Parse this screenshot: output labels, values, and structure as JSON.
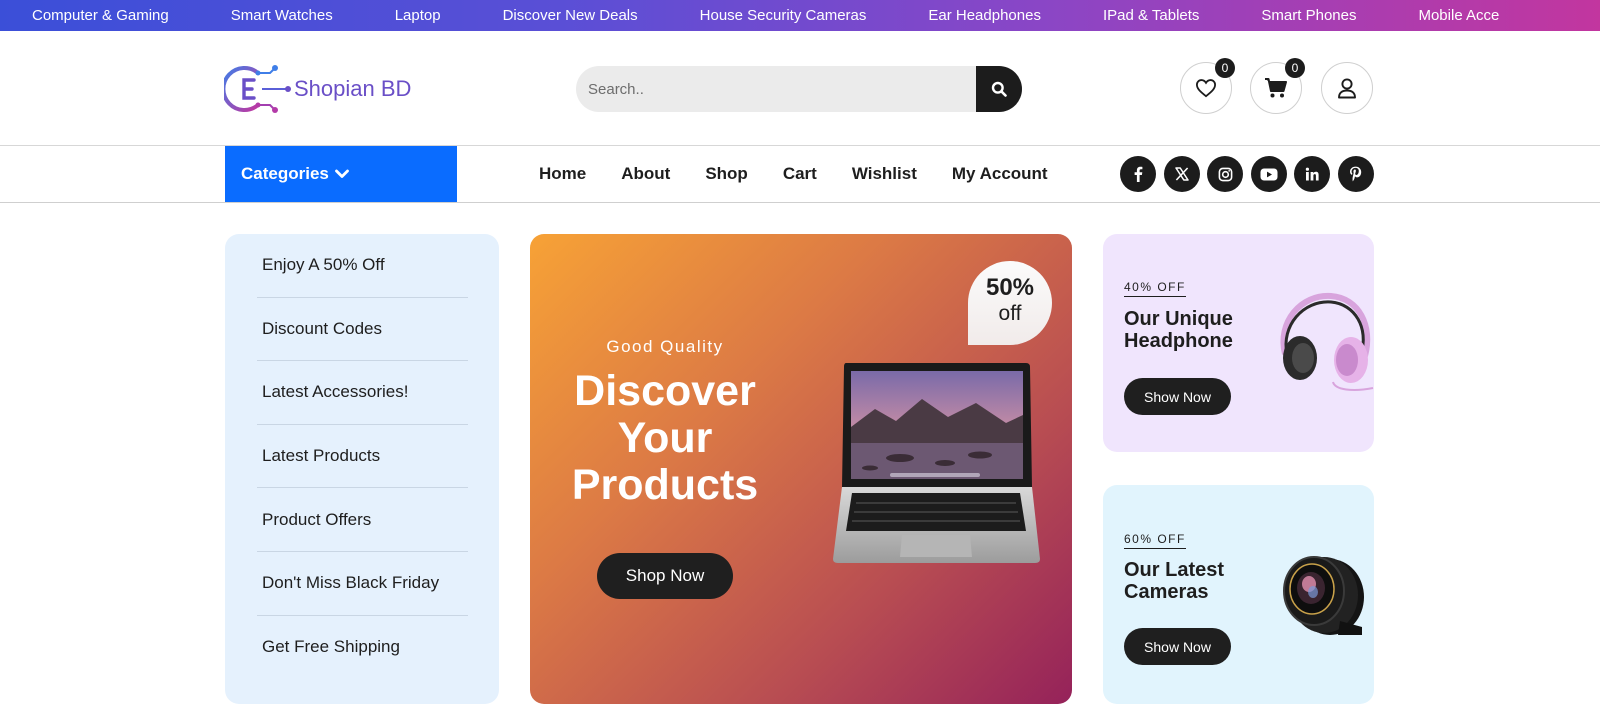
{
  "top_bar": {
    "items": [
      "Computer & Gaming",
      "Smart Watches",
      "Laptop",
      "Discover New Deals",
      "House Security Cameras",
      "Ear Headphones",
      "IPad & Tablets",
      "Smart Phones",
      "Mobile Acce"
    ]
  },
  "header": {
    "logo_text": "Shopian BD",
    "search_placeholder": "Search..",
    "wishlist_count": "0",
    "cart_count": "0"
  },
  "nav": {
    "categories_label": "Categories",
    "links": [
      "Home",
      "About",
      "Shop",
      "Cart",
      "Wishlist",
      "My Account"
    ],
    "socials": [
      "facebook-icon",
      "x-icon",
      "instagram-icon",
      "youtube-icon",
      "linkedin-icon",
      "pinterest-icon"
    ]
  },
  "promo_list": [
    "Enjoy A 50% Off",
    "Discount Codes",
    "Latest Accessories!",
    "Latest Products",
    "Product Offers",
    "Don't Miss Black Friday",
    "Get Free Shipping"
  ],
  "hero": {
    "eyebrow": "Good Quality",
    "title_line1": "Discover",
    "title_line2": "Your",
    "title_line3": "Products",
    "button": "Shop Now",
    "discount_pct": "50%",
    "discount_off": "off"
  },
  "side_cards": [
    {
      "tag": "40% OFF",
      "title_line1": "Our Unique",
      "title_line2": "Headphone",
      "button": "Show Now"
    },
    {
      "tag": "60% OFF",
      "title_line1": "Our Latest",
      "title_line2": "Cameras",
      "button": "Show Now"
    }
  ],
  "colors": {
    "topbar_gradient": [
      "#3b4fd8",
      "#c2369f"
    ],
    "categories_bg": "#0a6cff",
    "hero_gradient": [
      "#f7a236",
      "#95225a"
    ],
    "promo_bg": "#e5f1fd",
    "card_a_bg": "#f0e5fd",
    "card_b_bg": "#e1f4fd",
    "dark": "#1c1c1c"
  }
}
